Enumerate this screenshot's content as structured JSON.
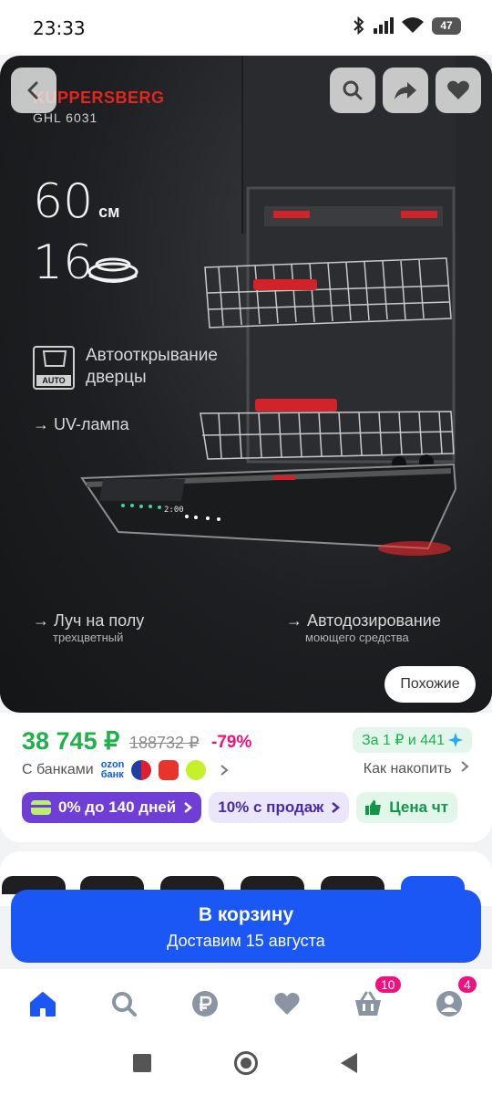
{
  "status_bar": {
    "time": "23:33",
    "battery": "47"
  },
  "hero": {
    "brand": "KUPPERSBERG",
    "model": "GHL 6031",
    "spec_width_value": "60",
    "spec_width_unit": "см",
    "spec_sets_value": "16",
    "auto_label": "AUTO",
    "feature_auto_door_line1": "Автооткрывание",
    "feature_auto_door_line2": "дверцы",
    "feature_uv": "→ UV-лампа",
    "feature_floor_beam": "→ Луч на полу",
    "feature_floor_beam_sub": "трехцветный",
    "feature_autodose": "→ Автодозирование",
    "feature_autodose_sub": "моющего средства",
    "similar_button": "Похожие"
  },
  "overlay_icons": [
    "back-icon",
    "search-icon",
    "share-icon",
    "heart-icon"
  ],
  "price": {
    "current": "38 745 ₽",
    "old": "188732 ₽",
    "discount": "-79%",
    "points": "За 1 ₽ и 441",
    "banks_label": "С банками",
    "ozon_bank_line1": "ozon",
    "ozon_bank_line2": "банк",
    "save_link": "Как накопить"
  },
  "chips": [
    {
      "label": "0% до 140 дней"
    },
    {
      "label": "10% с продаж"
    },
    {
      "label": "Цена чт"
    }
  ],
  "cart": {
    "title": "В корзину",
    "subtitle": "Доставим 15 августа"
  },
  "tabbar": {
    "items": [
      "home-icon",
      "search-icon",
      "ruble-icon",
      "heart-icon",
      "cart-icon",
      "profile-icon"
    ],
    "cart_badge": "10",
    "profile_badge": "4"
  },
  "colors": {
    "accent_blue": "#1a57f5",
    "price_green": "#1fb14a",
    "discount_pink": "#f1117e",
    "brand_red": "#e1261c",
    "chip_purple": "#6e3ed6"
  }
}
